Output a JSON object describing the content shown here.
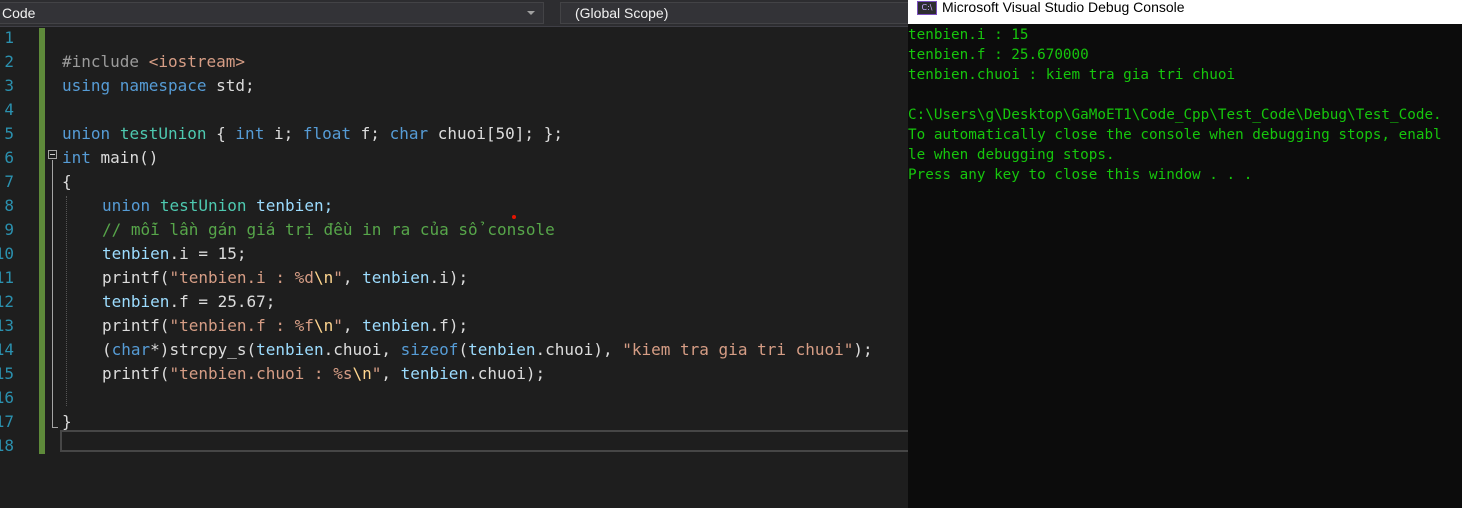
{
  "editor": {
    "project_dropdown": "Code",
    "scope_dropdown": "(Global Scope)",
    "line_numbers": [
      "1",
      "2",
      "3",
      "4",
      "5",
      "6",
      "7",
      "8",
      "9",
      "10",
      "11",
      "12",
      "13",
      "14",
      "15",
      "16",
      "17",
      "18"
    ],
    "code": {
      "l2_include": "#include",
      "l2_header": "<iostream>",
      "l3_using": "using namespace",
      "l3_rest": " std;",
      "l5_union": "union",
      "l5_type": "testUnion",
      "l5_open": " { ",
      "l5_int": "int",
      "l5_i": " i; ",
      "l5_float": "float",
      "l5_f": " f; ",
      "l5_char": "char",
      "l5_rest": " chuoi[50]; };",
      "l6_int": "int",
      "l6_main": " main()",
      "l7_brace": "{",
      "l8_union": "union",
      "l8_type": "testUnion",
      "l8_rest": " tenbien;",
      "l9_comment": "// mỗi lần gán giá trị đều in ra của sổ console",
      "l10_var": "tenbien",
      "l10_rest": ".i = 15;",
      "l11_fn": "printf",
      "l11_paren": "(",
      "l11_str1": "\"tenbien.i : %d",
      "l11_esc": "\\n",
      "l11_str2": "\"",
      "l11_comma": ", ",
      "l11_var": "tenbien",
      "l11_rest": ".i);",
      "l12_var": "tenbien",
      "l12_rest": ".f = 25.67;",
      "l13_fn": "printf",
      "l13_paren": "(",
      "l13_str1": "\"tenbien.f : %f",
      "l13_esc": "\\n",
      "l13_str2": "\"",
      "l13_comma": ", ",
      "l13_var": "tenbien",
      "l13_rest": ".f);",
      "l14_open": "(",
      "l14_char": "char",
      "l14_cast": "*)",
      "l14_fn": "strcpy_s",
      "l14_paren": "(",
      "l14_var1": "tenbien",
      "l14_mid1": ".chuoi, ",
      "l14_sizeof": "sizeof",
      "l14_paren2": "(",
      "l14_var2": "tenbien",
      "l14_mid2": ".chuoi), ",
      "l14_str": "\"kiem tra gia tri chuoi\"",
      "l14_end": ");",
      "l15_fn": "printf",
      "l15_paren": "(",
      "l15_str1": "\"tenbien.chuoi : %s",
      "l15_esc": "\\n",
      "l15_str2": "\"",
      "l15_comma": ", ",
      "l15_var": "tenbien",
      "l15_rest": ".chuoi);",
      "l17_brace": "}"
    }
  },
  "console": {
    "title": "Microsoft Visual Studio Debug Console",
    "icon_text": "C:\\",
    "lines": [
      "tenbien.i : 15",
      "tenbien.f : 25.670000",
      "tenbien.chuoi : kiem tra gia tri chuoi",
      "",
      "C:\\Users\\g\\Desktop\\GaMoET1\\Code_Cpp\\Test_Code\\Debug\\Test_Code.",
      "To automatically close the console when debugging stops, enabl",
      "le when debugging stops.",
      "Press any key to close this window . . ."
    ]
  },
  "colors": {
    "editor_bg": "#1e1e1e",
    "console_bg": "#0c0c0c",
    "console_text": "#16c60c",
    "keyword": "#569cd6",
    "type": "#4ec9b0",
    "string": "#d69d85",
    "comment": "#57a64a",
    "line_number": "#2b91af"
  }
}
